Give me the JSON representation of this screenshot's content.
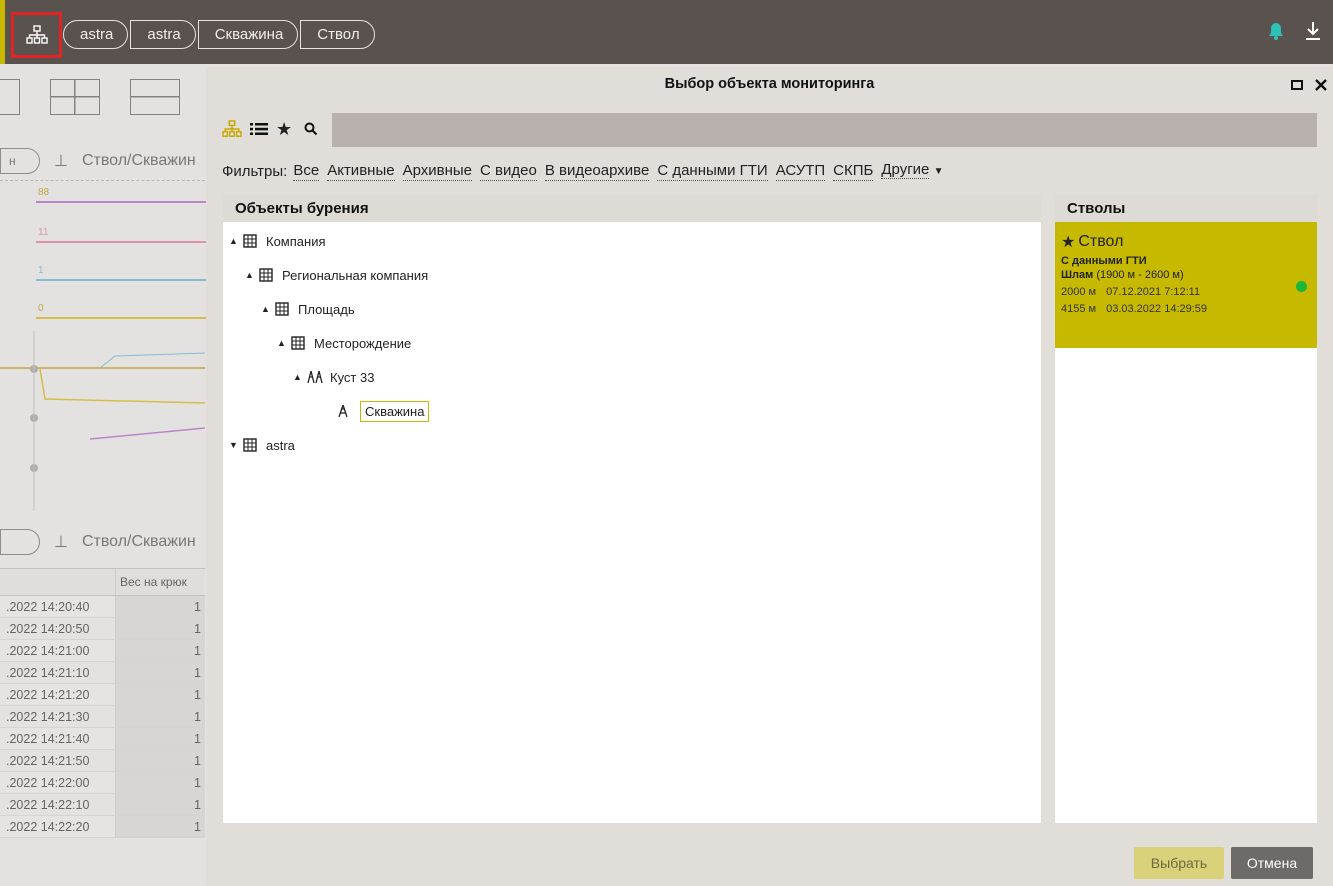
{
  "header": {
    "breadcrumbs": [
      "astra",
      "astra",
      "Скважина",
      "Ствол"
    ]
  },
  "background": {
    "tab_label": "Ствол/Скважин",
    "tab_label_2": "Ствол/Скважин",
    "track_values": [
      "88",
      "11",
      "1",
      "0"
    ],
    "table_header": "Вес на крюк",
    "table_rows": [
      ".2022 14:20:40",
      ".2022 14:20:50",
      ".2022 14:21:00",
      ".2022 14:21:10",
      ".2022 14:21:20",
      ".2022 14:21:30",
      ".2022 14:21:40",
      ".2022 14:21:50",
      ".2022 14:22:00",
      ".2022 14:22:10",
      ".2022 14:22:20"
    ],
    "table_value": "1"
  },
  "dialog": {
    "title": "Выбор объекта мониторинга",
    "filters_label": "Фильтры:",
    "filters": [
      "Все",
      "Активные",
      "Архивные",
      "С видео",
      "В видеоархиве",
      "С данными ГТИ",
      "АСУТП",
      "СКПБ",
      "Другие"
    ],
    "left_panel_title": "Объекты бурения",
    "right_panel_title": "Стволы",
    "tree": [
      {
        "label": "Компания",
        "level": 0,
        "expanded": true,
        "icon": "building-icon"
      },
      {
        "label": "Региональная компания",
        "level": 1,
        "expanded": true,
        "icon": "building-icon"
      },
      {
        "label": "Площадь",
        "level": 2,
        "expanded": true,
        "icon": "building-icon"
      },
      {
        "label": "Месторождение",
        "level": 3,
        "expanded": true,
        "icon": "building-icon"
      },
      {
        "label": "Куст 33",
        "level": 4,
        "expanded": true,
        "icon": "cluster-icon"
      },
      {
        "label": "Скважина",
        "level": 5,
        "expanded": false,
        "icon": "rig-icon",
        "selected": true
      },
      {
        "label": "astra",
        "level": 0,
        "expanded": false,
        "icon": "building-icon"
      }
    ],
    "bore": {
      "name": "Ствол",
      "subtitle": "С данными ГТИ",
      "sludge_label": "Шлам",
      "sludge_range": "(1900 м - 2600 м)",
      "row1_depth": "2000 м",
      "row1_date": "07.12.2021 7:12:11",
      "row2_depth": "4155 м",
      "row2_date": "03.03.2022 14:29:59",
      "status_color": "#1fb43a"
    },
    "select_button": "Выбрать",
    "cancel_button": "Отмена"
  }
}
